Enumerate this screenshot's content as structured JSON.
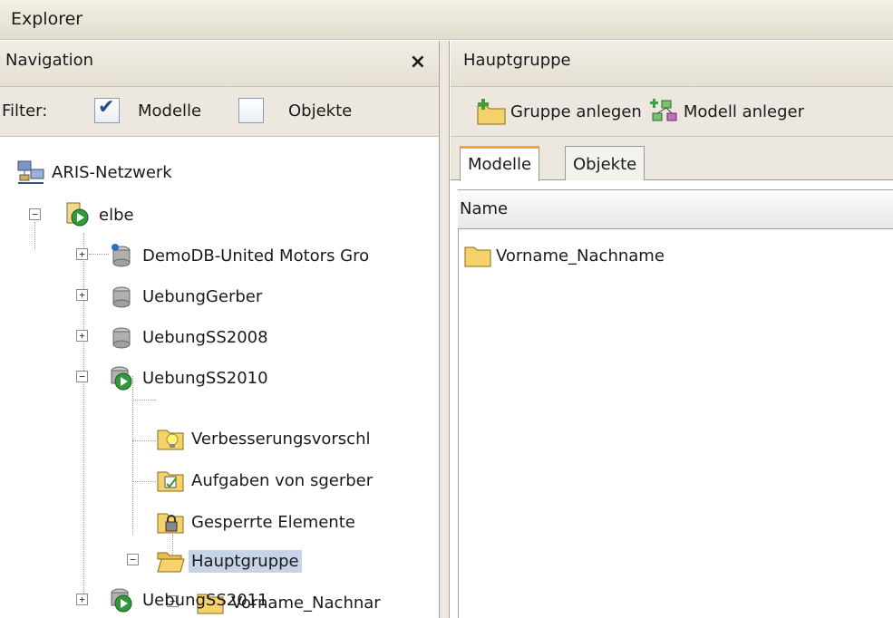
{
  "app": {
    "title": "Explorer"
  },
  "navigation": {
    "title": "Navigation",
    "close_glyph": "×",
    "filter": {
      "label": "Filter:",
      "options": [
        {
          "label": "Modelle",
          "checked": true
        },
        {
          "label": "Objekte",
          "checked": false
        }
      ]
    },
    "tree": {
      "root": "ARIS-Netzwerk",
      "server": "elbe",
      "databases": {
        "demo": "DemoDB-United Motors Gro",
        "gerber": "UebungGerber",
        "ss2008": "UebungSS2008",
        "ss2010": "UebungSS2010",
        "ss2011": "UebungSS2011"
      },
      "ss2010_children": {
        "verbesserung": "Verbesserungsvorschl",
        "aufgaben": "Aufgaben von sgerber",
        "gesperrt": "Gesperrte Elemente",
        "hauptgruppe": "Hauptgruppe",
        "vorname": "Vorname_Nachnar"
      },
      "selected": "Hauptgruppe"
    }
  },
  "main": {
    "title": "Hauptgruppe",
    "toolbar": {
      "create_group": "Gruppe anlegen",
      "create_model": "Modell anleger"
    },
    "tabs": [
      {
        "label": "Modelle",
        "active": true
      },
      {
        "label": "Objekte",
        "active": false
      }
    ],
    "list": {
      "column_name": "Name",
      "rows": [
        {
          "name": "Vorname_Nachname"
        }
      ]
    }
  },
  "colors": {
    "selection": "#c7d3e6",
    "active_tab_accent": "#f0a630",
    "panel": "#ece8df",
    "folder": "#f5d36a"
  }
}
